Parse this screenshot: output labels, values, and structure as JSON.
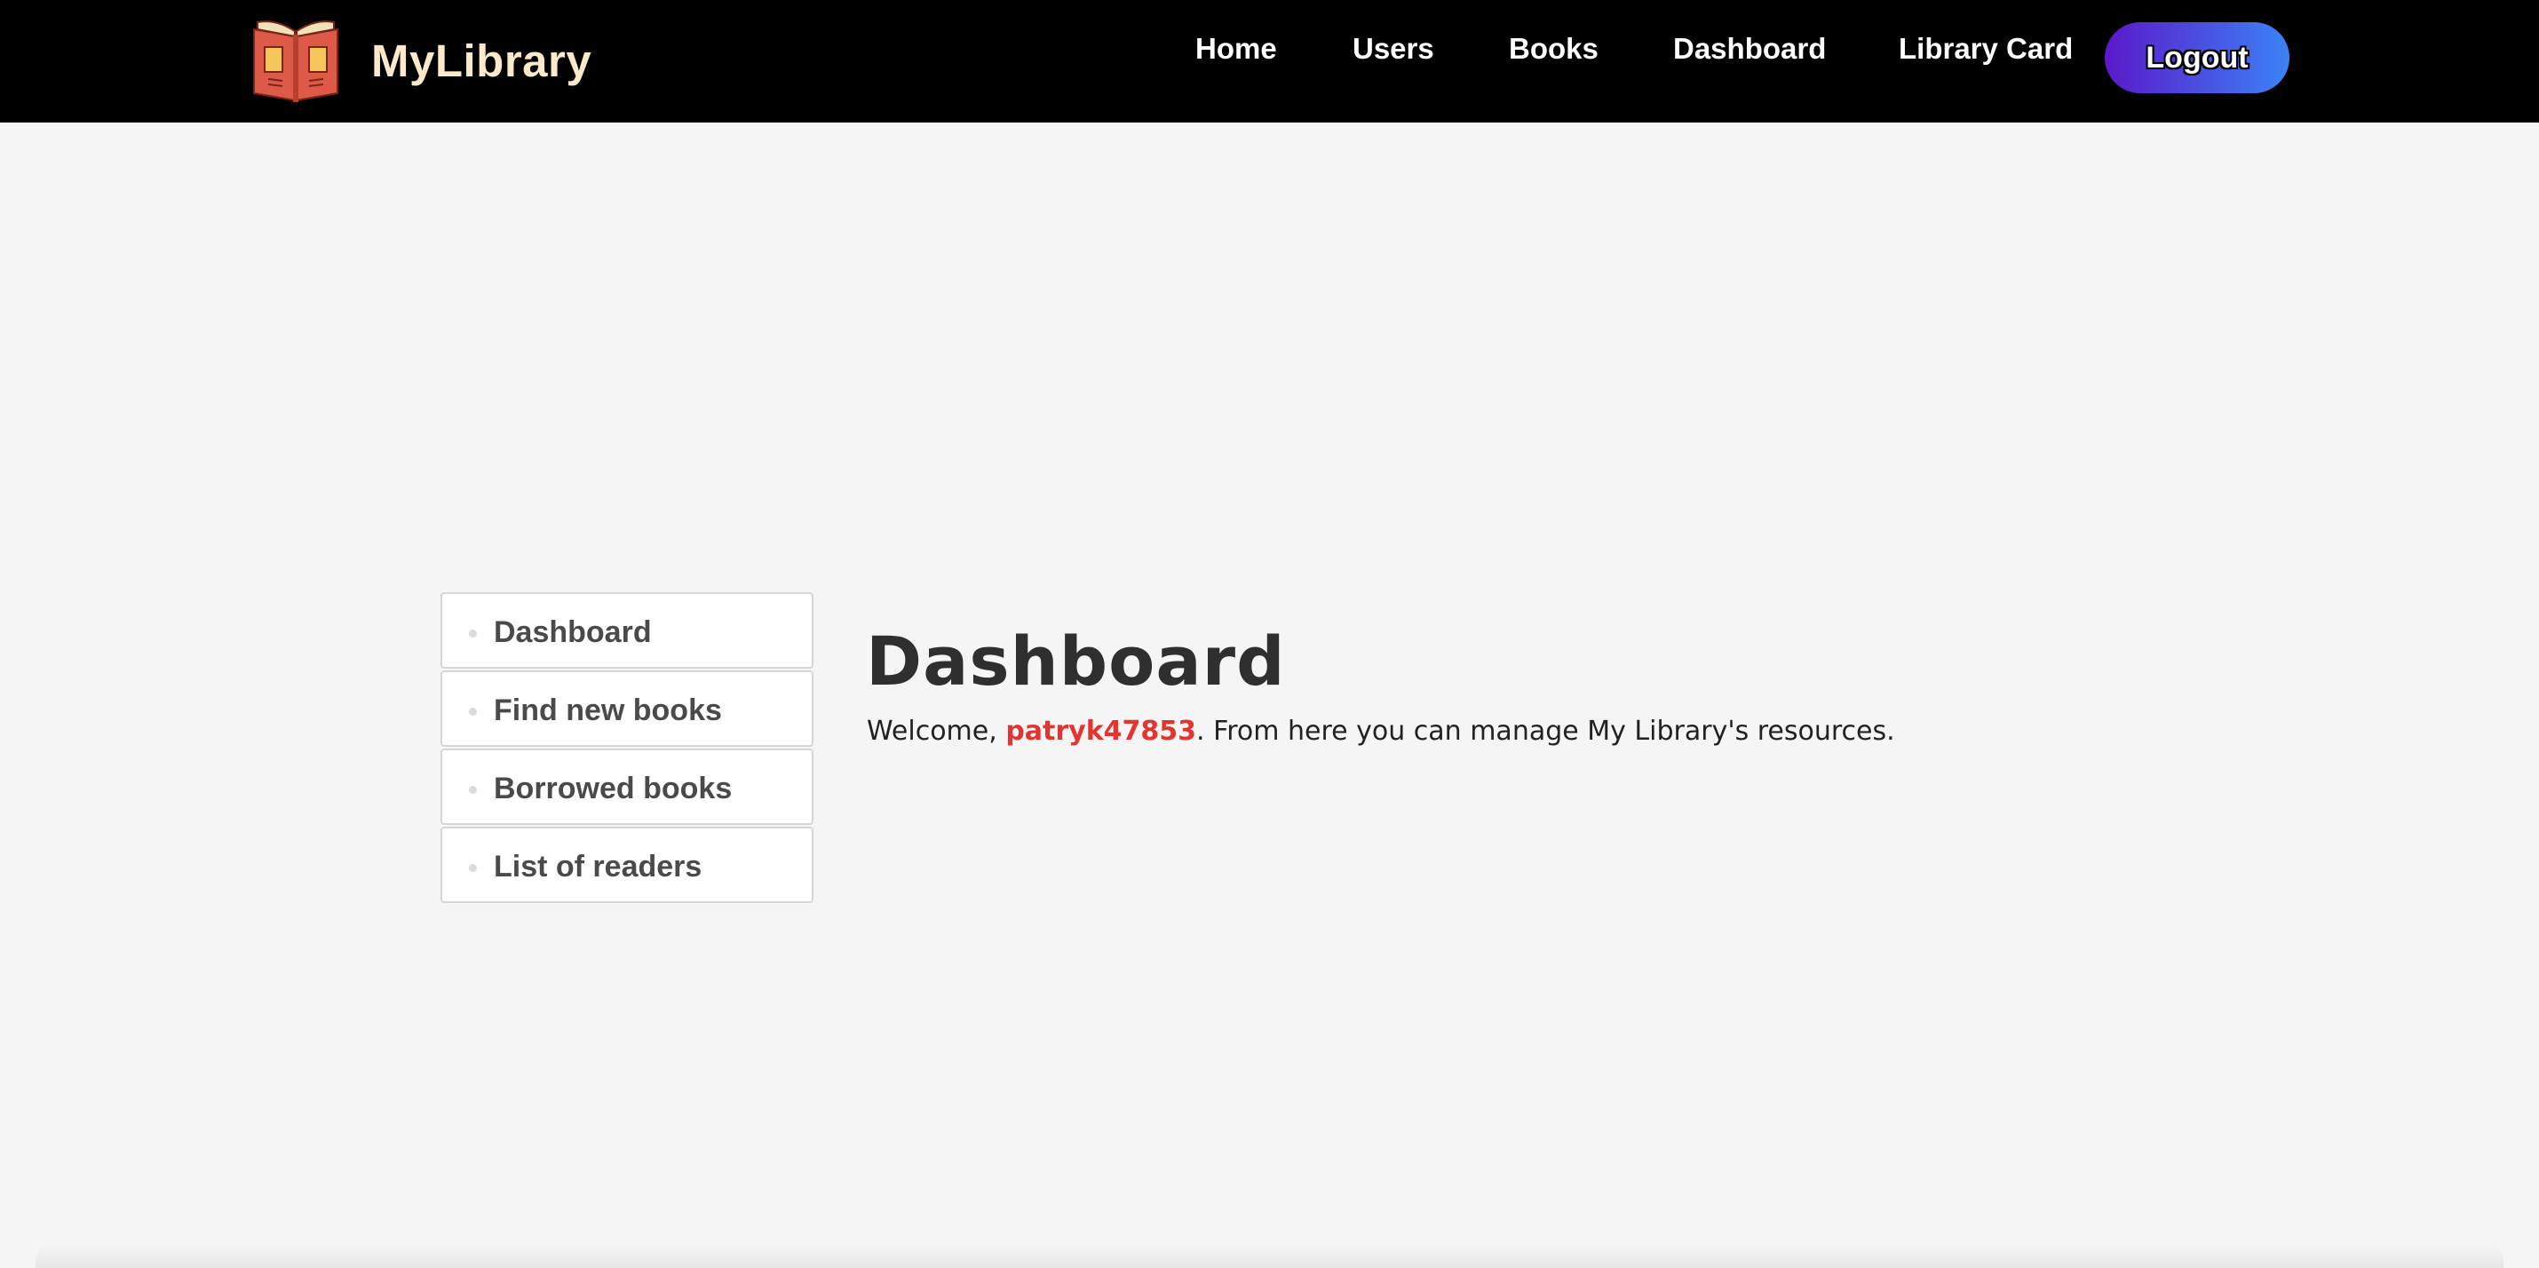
{
  "brand": {
    "name": "MyLibrary",
    "logo_icon": "open-book-icon"
  },
  "nav": {
    "links": [
      {
        "label": "Home"
      },
      {
        "label": "Users"
      },
      {
        "label": "Books"
      },
      {
        "label": "Dashboard"
      },
      {
        "label": "Library Card"
      }
    ],
    "logout_label": "Logout"
  },
  "sidebar": {
    "items": [
      {
        "label": "Dashboard"
      },
      {
        "label": "Find new books"
      },
      {
        "label": "Borrowed books"
      },
      {
        "label": "List of readers"
      }
    ]
  },
  "main": {
    "title": "Dashboard",
    "welcome_prefix": "Welcome, ",
    "username": "patryk47853",
    "welcome_suffix": ". From here you can manage My Library's resources."
  },
  "colors": {
    "navbar_bg": "#000000",
    "brand_text": "#fbe9c9",
    "logout_gradient_start": "#5b19c9",
    "logout_gradient_end": "#3b82f6",
    "username_accent": "#e3342f",
    "page_bg": "#f5f5f5"
  }
}
